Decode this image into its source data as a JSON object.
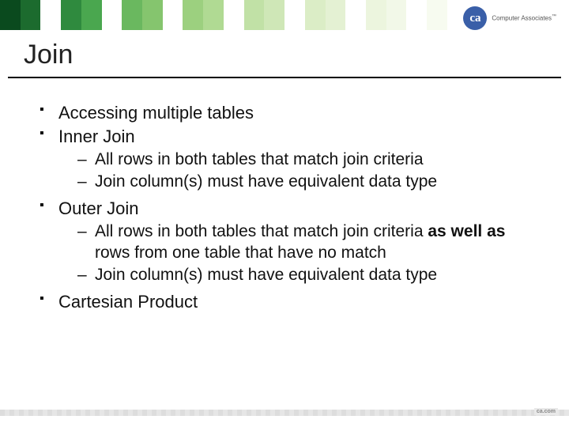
{
  "brand": {
    "logo_letters": "ca",
    "logo_label": "Computer Associates",
    "tm": "™"
  },
  "band_colors": [
    "#0a4a1e",
    "#1c6b2e",
    "#ffffff",
    "#2f8a3e",
    "#4aa74f",
    "#ffffff",
    "#6ab85f",
    "#85c56e",
    "#ffffff",
    "#9cd07f",
    "#b0da93",
    "#ffffff",
    "#c1e1a6",
    "#cfe7b7",
    "#ffffff",
    "#dbedc6",
    "#e4f1d3",
    "#ffffff",
    "#ecf5de",
    "#f2f8e8",
    "#ffffff",
    "#f7fbf0",
    "#ffffff",
    "#ffffff",
    "#ffffff",
    "#ffffff",
    "#ffffff",
    "#ffffff"
  ],
  "title": "Join",
  "bullets": [
    {
      "text": "Accessing multiple tables"
    },
    {
      "text": "Inner Join",
      "sub": [
        {
          "text": "All rows in both tables that match join criteria"
        },
        {
          "text": "Join column(s) must have equivalent data type"
        }
      ]
    },
    {
      "text": "Outer Join",
      "sub": [
        {
          "pre": "All rows in both tables that match join criteria ",
          "bold": "as well as",
          "post": " rows from one table that have no match"
        },
        {
          "text": "Join column(s) must have equivalent data type"
        }
      ]
    },
    {
      "text": "Cartesian Product"
    }
  ],
  "footer": "ca.com"
}
